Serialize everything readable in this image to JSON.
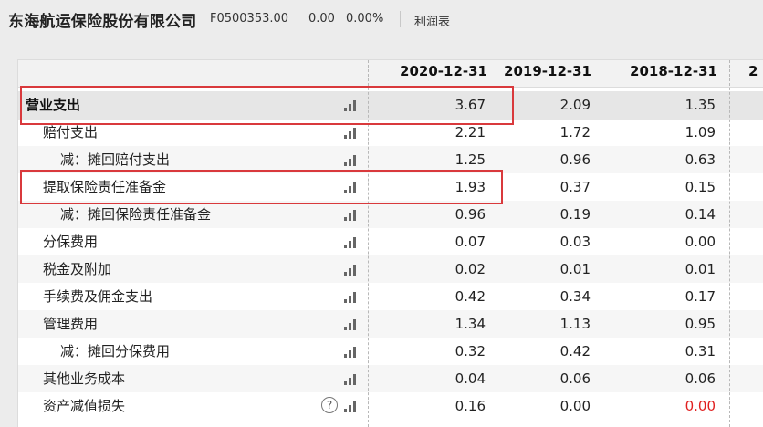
{
  "header": {
    "company": "东海航运保险股份有限公司",
    "code": "F0500353.00",
    "price": "0.00",
    "change_pct": "0.00%",
    "report_type": "利润表"
  },
  "table": {
    "columns": [
      "2020-12-31",
      "2019-12-31",
      "2018-12-31",
      "2"
    ],
    "rows": [
      {
        "label": "营业支出",
        "values": [
          "3.67",
          "2.09",
          "1.35"
        ]
      },
      {
        "label": "赔付支出",
        "values": [
          "2.21",
          "1.72",
          "1.09"
        ]
      },
      {
        "label": "减：摊回赔付支出",
        "values": [
          "1.25",
          "0.96",
          "0.63"
        ]
      },
      {
        "label": "提取保险责任准备金",
        "values": [
          "1.93",
          "0.37",
          "0.15"
        ]
      },
      {
        "label": "减：摊回保险责任准备金",
        "values": [
          "0.96",
          "0.19",
          "0.14"
        ]
      },
      {
        "label": "分保费用",
        "values": [
          "0.07",
          "0.03",
          "0.00"
        ]
      },
      {
        "label": "税金及附加",
        "values": [
          "0.02",
          "0.01",
          "0.01"
        ]
      },
      {
        "label": "手续费及佣金支出",
        "values": [
          "0.42",
          "0.34",
          "0.17"
        ]
      },
      {
        "label": "管理费用",
        "values": [
          "1.34",
          "1.13",
          "0.95"
        ]
      },
      {
        "label": "减：摊回分保费用",
        "values": [
          "0.32",
          "0.42",
          "0.31"
        ]
      },
      {
        "label": "其他业务成本",
        "values": [
          "0.04",
          "0.06",
          "0.06"
        ]
      },
      {
        "label": "资产减值损失",
        "values": [
          "0.16",
          "0.00",
          "0.00"
        ]
      }
    ]
  },
  "colors": {
    "highlight_box": "#d9393c",
    "negative_value": "#e02020"
  }
}
